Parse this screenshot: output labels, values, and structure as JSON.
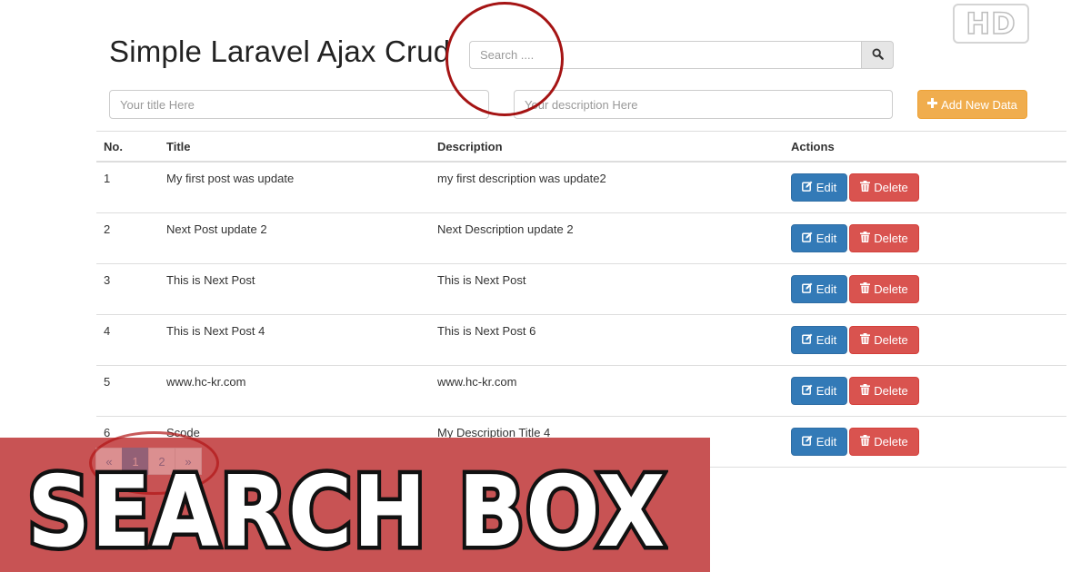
{
  "badge": {
    "text": "HD"
  },
  "page": {
    "title": "Simple Laravel Ajax Crud"
  },
  "search": {
    "placeholder": "Search ...."
  },
  "form": {
    "title_placeholder": "Your title Here",
    "description_placeholder": "Your description Here",
    "add_label": "Add New Data"
  },
  "table": {
    "headers": {
      "no": "No.",
      "title": "Title",
      "description": "Description",
      "actions": "Actions"
    },
    "rows": [
      {
        "no": "1",
        "title": "My first post was update",
        "description": "my first description was update2"
      },
      {
        "no": "2",
        "title": "Next Post update 2",
        "description": "Next Description update 2"
      },
      {
        "no": "3",
        "title": "This is Next Post",
        "description": "This is Next Post"
      },
      {
        "no": "4",
        "title": "This is Next Post 4",
        "description": "This is Next Post 6"
      },
      {
        "no": "5",
        "title": "www.hc-kr.com",
        "description": "www.hc-kr.com"
      },
      {
        "no": "6",
        "title": "Scode",
        "description": "My Description Title 4"
      }
    ],
    "edit_label": "Edit",
    "delete_label": "Delete"
  },
  "pagination": {
    "prev": "«",
    "pages": [
      "1",
      "2"
    ],
    "next": "»",
    "active": "1"
  },
  "banner": {
    "text": "SEARCH BOX"
  },
  "colors": {
    "primary": "#337ab7",
    "danger": "#d9534f",
    "warning": "#f0ad4e",
    "banner": "#c85354",
    "annotation": "#a51414"
  },
  "icons": {
    "search": "search-icon",
    "add": "plus-icon",
    "edit": "edit-icon",
    "delete": "trash-icon"
  }
}
